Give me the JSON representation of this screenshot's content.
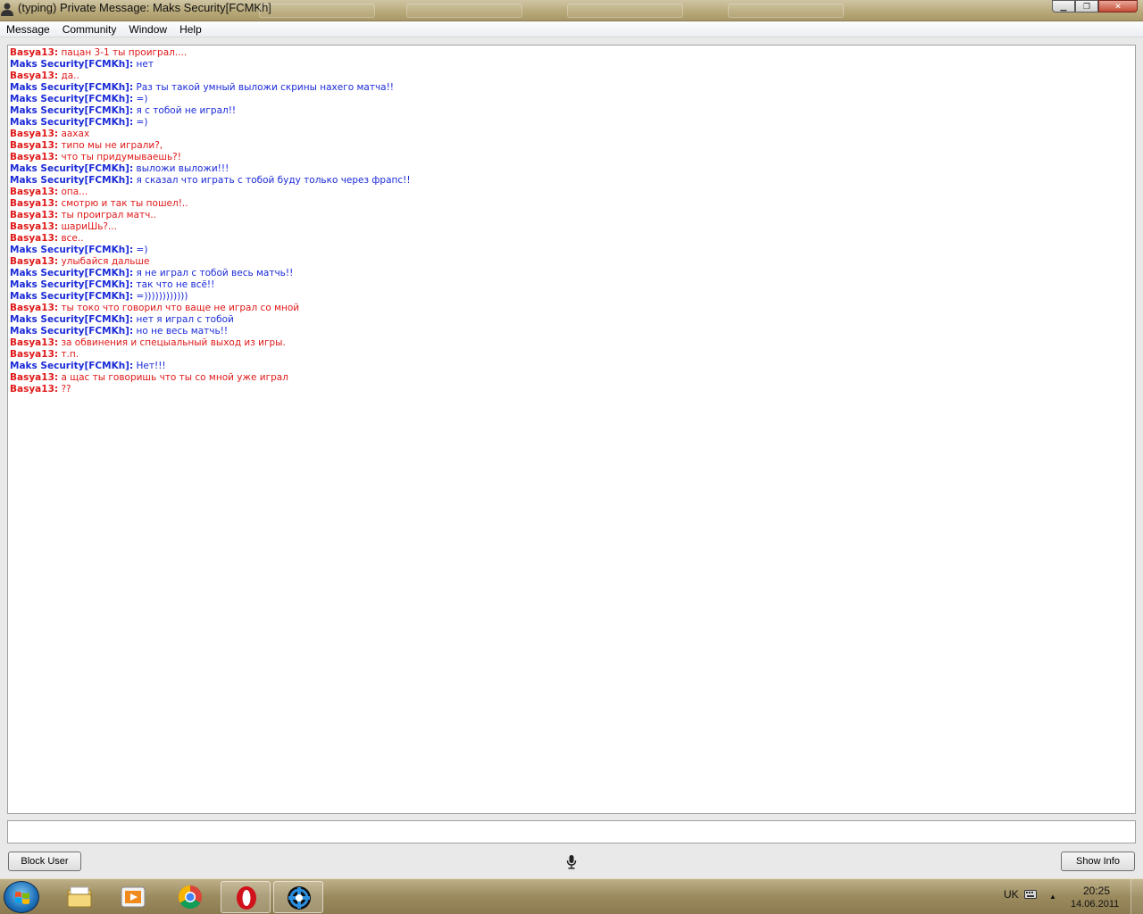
{
  "window": {
    "title": "(typing) Private Message: Maks Security[FCMKh]"
  },
  "menu": [
    "Message",
    "Community",
    "Window",
    "Help"
  ],
  "colors": {
    "basya": "#e01818",
    "maks": "#1a2ad8"
  },
  "messages": [
    {
      "user": "Basya13:",
      "text": "пацан 3-1 ты проиграл....",
      "cls": "basya"
    },
    {
      "user": "Maks Security[FCMKh]:",
      "text": "нет",
      "cls": "maks"
    },
    {
      "user": "Basya13:",
      "text": "да..",
      "cls": "basya"
    },
    {
      "user": "Maks Security[FCMKh]:",
      "text": "Раз ты такой умный выложи скрины нахего матча!!",
      "cls": "maks"
    },
    {
      "user": "Maks Security[FCMKh]:",
      "text": "=)",
      "cls": "maks"
    },
    {
      "user": "Maks Security[FCMKh]:",
      "text": "я с тобой не играл!!",
      "cls": "maks"
    },
    {
      "user": "Maks Security[FCMKh]:",
      "text": "=)",
      "cls": "maks"
    },
    {
      "user": "Basya13:",
      "text": "аахах",
      "cls": "basya"
    },
    {
      "user": "Basya13:",
      "text": "типо мы не играли?,",
      "cls": "basya"
    },
    {
      "user": "Basya13:",
      "text": "что ты придумываешь?!",
      "cls": "basya"
    },
    {
      "user": "Maks Security[FCMKh]:",
      "text": "выложи выложи!!!",
      "cls": "maks"
    },
    {
      "user": "Maks Security[FCMKh]:",
      "text": "я сказал что играть с тобой буду только через фрапс!!",
      "cls": "maks"
    },
    {
      "user": "Basya13:",
      "text": "опа...",
      "cls": "basya"
    },
    {
      "user": "Basya13:",
      "text": "смотрю и так ты пошел!..",
      "cls": "basya"
    },
    {
      "user": "Basya13:",
      "text": "ты проиграл матч..",
      "cls": "basya"
    },
    {
      "user": "Basya13:",
      "text": "шариШь?...",
      "cls": "basya"
    },
    {
      "user": "Basya13:",
      "text": "все..",
      "cls": "basya"
    },
    {
      "user": "Maks Security[FCMKh]:",
      "text": "=)",
      "cls": "maks"
    },
    {
      "user": "Basya13:",
      "text": "улыбайся дальше",
      "cls": "basya"
    },
    {
      "user": "Maks Security[FCMKh]:",
      "text": "я не играл с тобой весь матчь!!",
      "cls": "maks"
    },
    {
      "user": "Maks Security[FCMKh]:",
      "text": "так что не всё!!",
      "cls": "maks"
    },
    {
      "user": "Maks Security[FCMKh]:",
      "text": "=))))))))))))",
      "cls": "maks"
    },
    {
      "user": "Basya13:",
      "text": "ты токо что говорил что ваще не играл со мной",
      "cls": "basya"
    },
    {
      "user": "Maks Security[FCMKh]:",
      "text": "нет я играл с тобой",
      "cls": "maks"
    },
    {
      "user": "Maks Security[FCMKh]:",
      "text": "но не весь матчь!!",
      "cls": "maks"
    },
    {
      "user": "Basya13:",
      "text": "за обвинения и спецыальный выход из игры.",
      "cls": "basya"
    },
    {
      "user": "Basya13:",
      "text": "т.п.",
      "cls": "basya"
    },
    {
      "user": "Maks Security[FCMKh]:",
      "text": "Нет!!!",
      "cls": "maks"
    },
    {
      "user": "Basya13:",
      "text": "а щас ты говоришь что ты со мной уже играл",
      "cls": "basya"
    },
    {
      "user": "Basya13:",
      "text": "??",
      "cls": "basya"
    }
  ],
  "input": {
    "value": ""
  },
  "buttons": {
    "block_user": "Block User",
    "show_info": "Show Info"
  },
  "taskbar": {
    "apps": [
      "windows-explorer",
      "media-player",
      "google-chrome",
      "opera",
      "steam"
    ],
    "language": "UK",
    "time": "20:25",
    "date": "14.06.2011"
  }
}
